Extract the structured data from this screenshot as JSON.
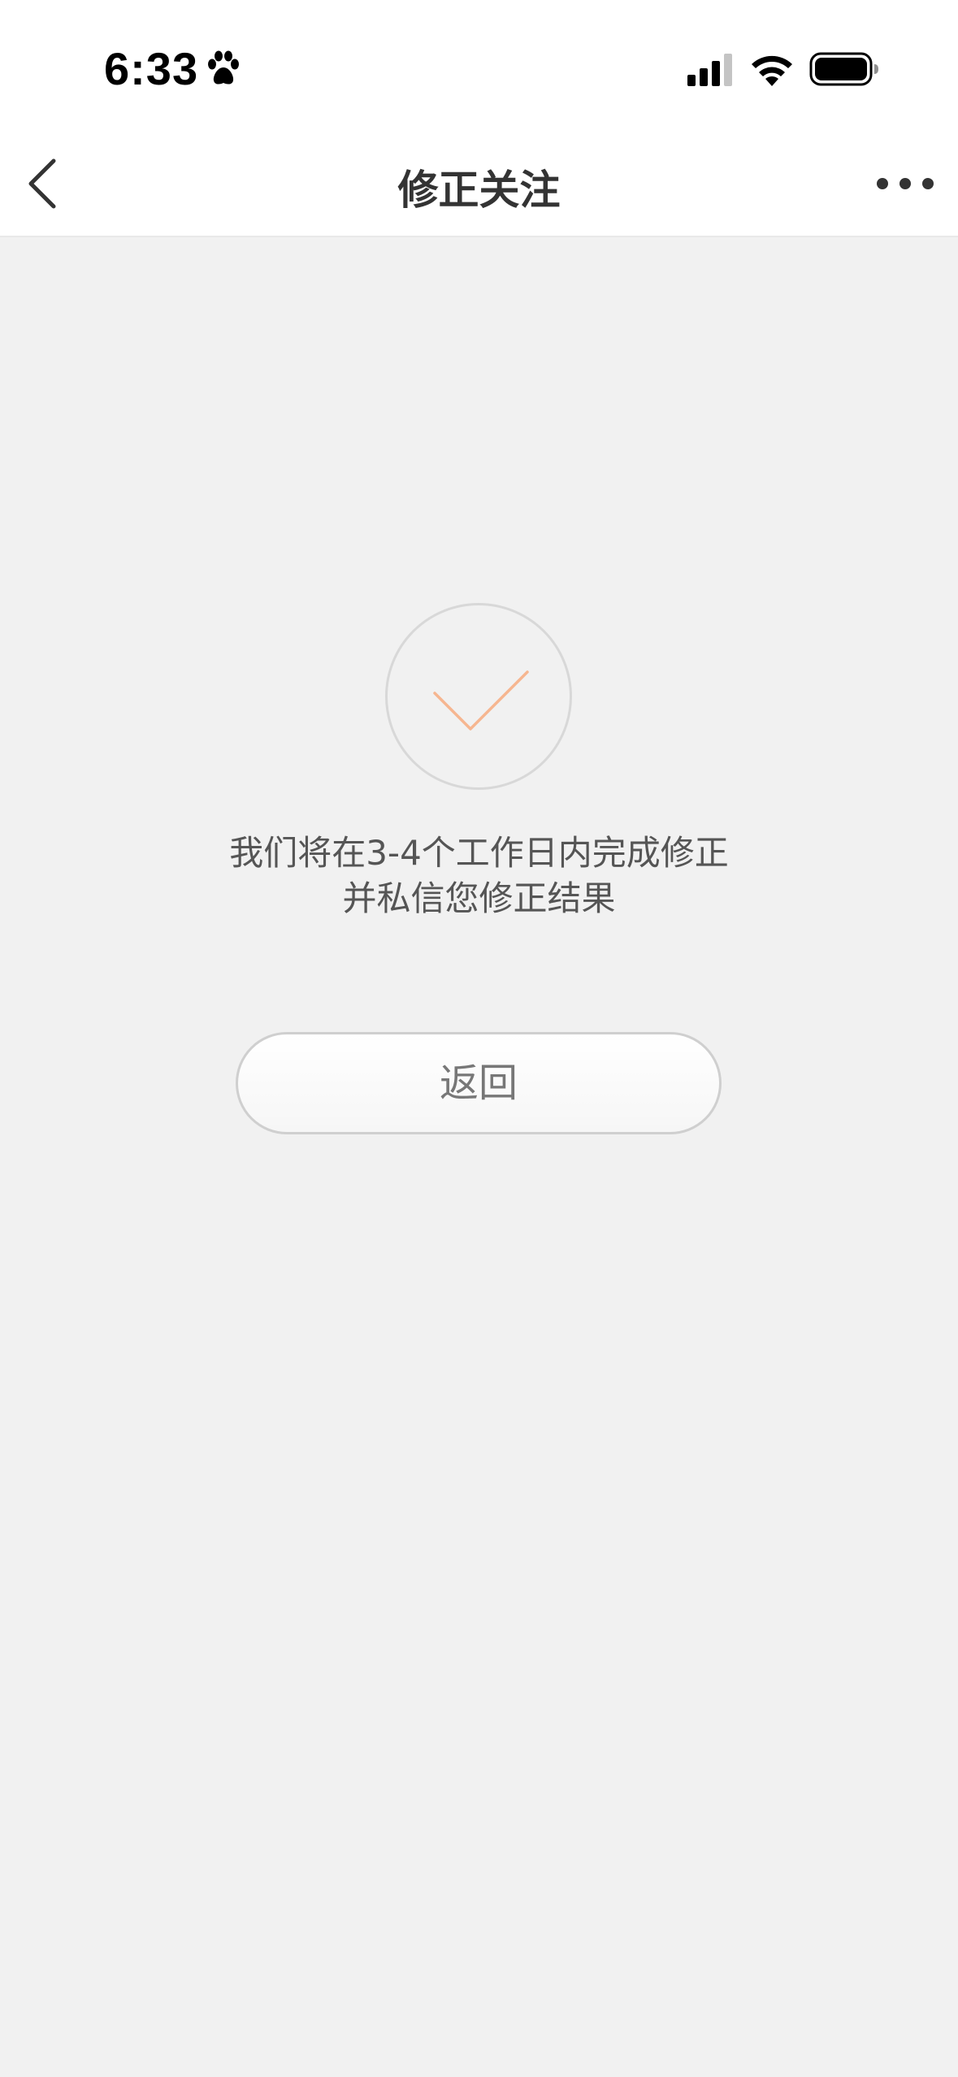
{
  "status_bar": {
    "time": "6:33",
    "icons": [
      "paw-icon",
      "signal-icon",
      "wifi-icon",
      "battery-icon"
    ]
  },
  "nav": {
    "title": "修正关注",
    "back_icon": "chevron-left-icon",
    "more_icon": "more-dots-icon"
  },
  "result": {
    "icon": "checkmark-icon",
    "check_color": "#f6b690",
    "message_line1": "我们将在3-4个工作日内完成修正",
    "message_line2": "并私信您修正结果",
    "return_label": "返回"
  }
}
